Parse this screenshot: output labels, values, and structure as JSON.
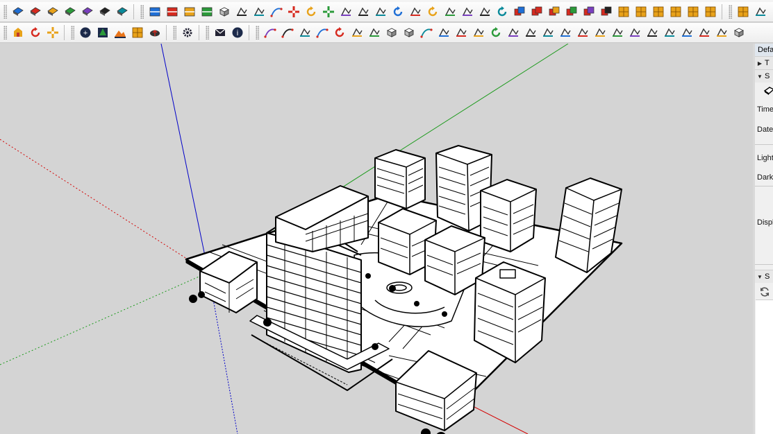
{
  "toolbars": {
    "row1": {
      "groups": [
        [
          "styles-xray-icon",
          "styles-backedges-icon",
          "styles-wireframe-icon",
          "styles-hiddenline-icon",
          "styles-shaded-icon",
          "styles-shaded-textures-icon",
          "styles-monochrome-icon"
        ],
        [
          "section-plane-icon",
          "section-display-icon",
          "section-cuts-icon",
          "section-fill-icon",
          "component-icon",
          "paint-icon",
          "tape-measure-icon",
          "line-icon",
          "move-icon",
          "rotate-icon",
          "scale-icon",
          "push-pull-icon",
          "follow-me-icon",
          "offset-icon",
          "arc-icon",
          "pie-icon",
          "circle-icon",
          "polygon-icon",
          "rectangle-icon",
          "bucket-icon",
          "undo-icon",
          "solid-union-icon",
          "solid-subtract-icon",
          "solid-split-icon",
          "solid-trim-icon",
          "solid-intersect-icon",
          "outer-shell-icon",
          "sandbox-smoove-icon",
          "sandbox-stamp-icon",
          "sandbox-drape-icon",
          "sandbox-grid-icon",
          "sandbox-flip-edge-icon",
          "sandbox-add-detail-icon"
        ],
        [
          "sandbox-from-contours-icon",
          "scene-manager-icon"
        ]
      ]
    },
    "row2": {
      "groups": [
        [
          "extension-warehouse-icon",
          "refresh-icon",
          "camera-move-icon"
        ],
        [
          "add-location-icon",
          "trees-icon",
          "terrain-icon",
          "checker-icon",
          "cloud-upload-icon"
        ],
        [
          "extension-manager-icon"
        ],
        [
          "mail-icon",
          "info-icon"
        ],
        [
          "freehand-icon",
          "bezier-icon",
          "eraser-icon",
          "knife-icon",
          "rotate-3d-icon",
          "select-loop-icon",
          "weld-icon",
          "box-icon",
          "extrude-icon",
          "curve-icon",
          "fillet-icon",
          "chamfer-icon",
          "offset-edge-icon",
          "arc-join-icon",
          "layer-icon",
          "cut-icon",
          "stairs-icon",
          "railing-icon",
          "hand-icon",
          "shape-bend-icon",
          "wall-icon",
          "fence-icon",
          "roof-icon",
          "ramp-icon",
          "dome-icon",
          "stairs-2-icon",
          "panel-icon",
          "cube-icon"
        ]
      ]
    }
  },
  "tray": {
    "tab_label": "Defa",
    "section1_label": "T",
    "section2_label": "S",
    "labels": [
      "Time",
      "Date",
      "Light",
      "Dark",
      "Displ"
    ],
    "section3_label": "S"
  },
  "colors": {
    "canvas_background": "#d4d4d4",
    "axis_red": "#d40000",
    "axis_green": "#1a9a1a",
    "axis_blue": "#0000c8",
    "model_line": "#000000"
  }
}
